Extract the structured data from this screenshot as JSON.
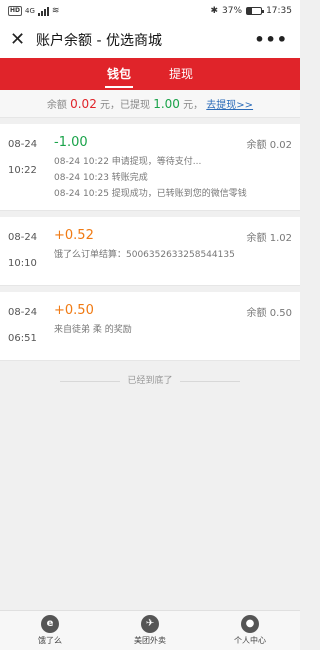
{
  "statusbar": {
    "hd": "HD",
    "net": "4G",
    "battery_pct": "37%",
    "battery_level": 0.37,
    "time": "17:35"
  },
  "navbar": {
    "close_icon": "close-icon",
    "title": "账户余额 - 优选商城",
    "more_icon": "more-icon"
  },
  "tabs": [
    {
      "label": "钱包",
      "active": true
    },
    {
      "label": "提现",
      "active": false
    }
  ],
  "summary": {
    "balance_label": "余额",
    "balance_value": "0.02",
    "unit1": "元，已提现",
    "withdrawn_value": "1.00",
    "unit2": "元，",
    "link": "去提现>>"
  },
  "records": [
    {
      "date": "08-24",
      "time": "10:22",
      "amount": "-1.00",
      "type": "neg",
      "balance": "余额 0.02",
      "details": [
        "08-24 10:22 申请提现，等待支付...",
        "08-24 10:23 转账完成",
        "08-24 10:25 提现成功，已转账到您的微信零钱"
      ]
    },
    {
      "date": "08-24",
      "time": "10:10",
      "amount": "+0.52",
      "type": "pos",
      "balance": "余额 1.02",
      "details": [
        "饿了么订单结算：5006352633258544135"
      ]
    },
    {
      "date": "08-24",
      "time": "06:51",
      "amount": "+0.50",
      "type": "pos",
      "balance": "余额 0.50",
      "details": [
        "来自徒弟 柔 的奖励"
      ]
    }
  ],
  "end_text": "已经到底了",
  "bottomnav": [
    {
      "label": "饿了么",
      "icon": "eleme-icon",
      "glyph": "e"
    },
    {
      "label": "美团外卖",
      "icon": "meituan-icon",
      "glyph": "✈"
    },
    {
      "label": "个人中心",
      "icon": "user-icon",
      "glyph": "●"
    }
  ]
}
